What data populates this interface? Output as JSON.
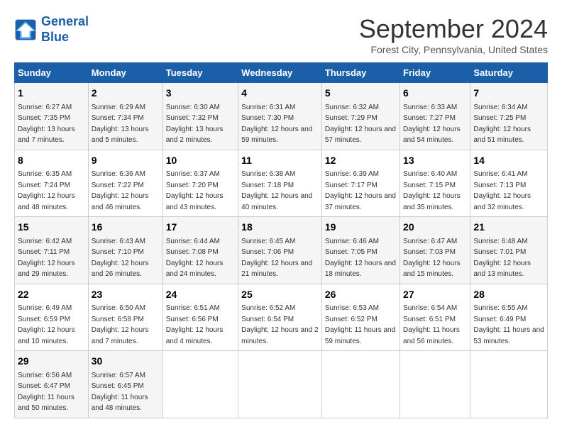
{
  "logo": {
    "line1": "General",
    "line2": "Blue"
  },
  "title": "September 2024",
  "subtitle": "Forest City, Pennsylvania, United States",
  "days_of_week": [
    "Sunday",
    "Monday",
    "Tuesday",
    "Wednesday",
    "Thursday",
    "Friday",
    "Saturday"
  ],
  "weeks": [
    [
      {
        "day": "1",
        "info": "Sunrise: 6:27 AM\nSunset: 7:35 PM\nDaylight: 13 hours and 7 minutes."
      },
      {
        "day": "2",
        "info": "Sunrise: 6:29 AM\nSunset: 7:34 PM\nDaylight: 13 hours and 5 minutes."
      },
      {
        "day": "3",
        "info": "Sunrise: 6:30 AM\nSunset: 7:32 PM\nDaylight: 13 hours and 2 minutes."
      },
      {
        "day": "4",
        "info": "Sunrise: 6:31 AM\nSunset: 7:30 PM\nDaylight: 12 hours and 59 minutes."
      },
      {
        "day": "5",
        "info": "Sunrise: 6:32 AM\nSunset: 7:29 PM\nDaylight: 12 hours and 57 minutes."
      },
      {
        "day": "6",
        "info": "Sunrise: 6:33 AM\nSunset: 7:27 PM\nDaylight: 12 hours and 54 minutes."
      },
      {
        "day": "7",
        "info": "Sunrise: 6:34 AM\nSunset: 7:25 PM\nDaylight: 12 hours and 51 minutes."
      }
    ],
    [
      {
        "day": "8",
        "info": "Sunrise: 6:35 AM\nSunset: 7:24 PM\nDaylight: 12 hours and 48 minutes."
      },
      {
        "day": "9",
        "info": "Sunrise: 6:36 AM\nSunset: 7:22 PM\nDaylight: 12 hours and 46 minutes."
      },
      {
        "day": "10",
        "info": "Sunrise: 6:37 AM\nSunset: 7:20 PM\nDaylight: 12 hours and 43 minutes."
      },
      {
        "day": "11",
        "info": "Sunrise: 6:38 AM\nSunset: 7:18 PM\nDaylight: 12 hours and 40 minutes."
      },
      {
        "day": "12",
        "info": "Sunrise: 6:39 AM\nSunset: 7:17 PM\nDaylight: 12 hours and 37 minutes."
      },
      {
        "day": "13",
        "info": "Sunrise: 6:40 AM\nSunset: 7:15 PM\nDaylight: 12 hours and 35 minutes."
      },
      {
        "day": "14",
        "info": "Sunrise: 6:41 AM\nSunset: 7:13 PM\nDaylight: 12 hours and 32 minutes."
      }
    ],
    [
      {
        "day": "15",
        "info": "Sunrise: 6:42 AM\nSunset: 7:11 PM\nDaylight: 12 hours and 29 minutes."
      },
      {
        "day": "16",
        "info": "Sunrise: 6:43 AM\nSunset: 7:10 PM\nDaylight: 12 hours and 26 minutes."
      },
      {
        "day": "17",
        "info": "Sunrise: 6:44 AM\nSunset: 7:08 PM\nDaylight: 12 hours and 24 minutes."
      },
      {
        "day": "18",
        "info": "Sunrise: 6:45 AM\nSunset: 7:06 PM\nDaylight: 12 hours and 21 minutes."
      },
      {
        "day": "19",
        "info": "Sunrise: 6:46 AM\nSunset: 7:05 PM\nDaylight: 12 hours and 18 minutes."
      },
      {
        "day": "20",
        "info": "Sunrise: 6:47 AM\nSunset: 7:03 PM\nDaylight: 12 hours and 15 minutes."
      },
      {
        "day": "21",
        "info": "Sunrise: 6:48 AM\nSunset: 7:01 PM\nDaylight: 12 hours and 13 minutes."
      }
    ],
    [
      {
        "day": "22",
        "info": "Sunrise: 6:49 AM\nSunset: 6:59 PM\nDaylight: 12 hours and 10 minutes."
      },
      {
        "day": "23",
        "info": "Sunrise: 6:50 AM\nSunset: 6:58 PM\nDaylight: 12 hours and 7 minutes."
      },
      {
        "day": "24",
        "info": "Sunrise: 6:51 AM\nSunset: 6:56 PM\nDaylight: 12 hours and 4 minutes."
      },
      {
        "day": "25",
        "info": "Sunrise: 6:52 AM\nSunset: 6:54 PM\nDaylight: 12 hours and 2 minutes."
      },
      {
        "day": "26",
        "info": "Sunrise: 6:53 AM\nSunset: 6:52 PM\nDaylight: 11 hours and 59 minutes."
      },
      {
        "day": "27",
        "info": "Sunrise: 6:54 AM\nSunset: 6:51 PM\nDaylight: 11 hours and 56 minutes."
      },
      {
        "day": "28",
        "info": "Sunrise: 6:55 AM\nSunset: 6:49 PM\nDaylight: 11 hours and 53 minutes."
      }
    ],
    [
      {
        "day": "29",
        "info": "Sunrise: 6:56 AM\nSunset: 6:47 PM\nDaylight: 11 hours and 50 minutes."
      },
      {
        "day": "30",
        "info": "Sunrise: 6:57 AM\nSunset: 6:45 PM\nDaylight: 11 hours and 48 minutes."
      },
      null,
      null,
      null,
      null,
      null
    ]
  ]
}
